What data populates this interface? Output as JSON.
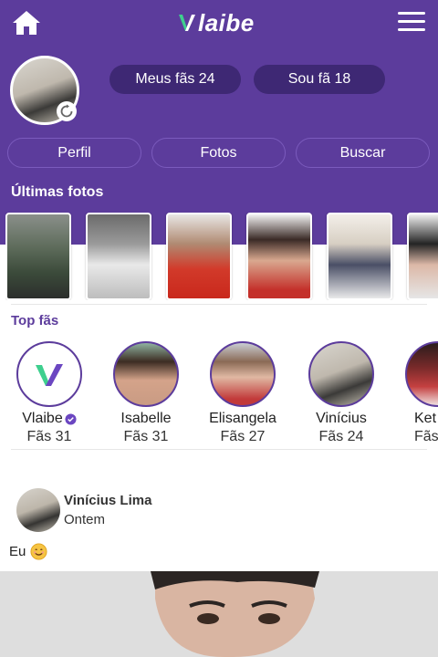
{
  "app": {
    "logo_text": "laibe"
  },
  "header": {
    "icons": [
      "home-icon",
      "menu-icon"
    ]
  },
  "profile": {
    "fans_button": "Meus fãs 24",
    "following_button": "Sou fã 18"
  },
  "tabs": [
    {
      "label": "Perfil"
    },
    {
      "label": "Fotos"
    },
    {
      "label": "Buscar"
    }
  ],
  "latest_photos": {
    "title": "Últimas fotos",
    "count": 6
  },
  "top_fans": {
    "title": "Top fãs",
    "items": [
      {
        "name": "Vlaibe",
        "count": "Fãs 31",
        "verified": true
      },
      {
        "name": "Isabelle",
        "count": "Fãs 31"
      },
      {
        "name": "Elisangela",
        "count": "Fãs 27"
      },
      {
        "name": "Vinícius",
        "count": "Fãs 24"
      },
      {
        "name": "Ket",
        "count": "Fãs"
      }
    ]
  },
  "post": {
    "author": "Vinícius Lima",
    "time": "Ontem",
    "text": "Eu"
  },
  "colors": {
    "brand_purple": "#5c3c9c",
    "pill_dark": "#3e2874",
    "logo_green": "#3ecf8e",
    "logo_purple": "#6b46c1"
  }
}
